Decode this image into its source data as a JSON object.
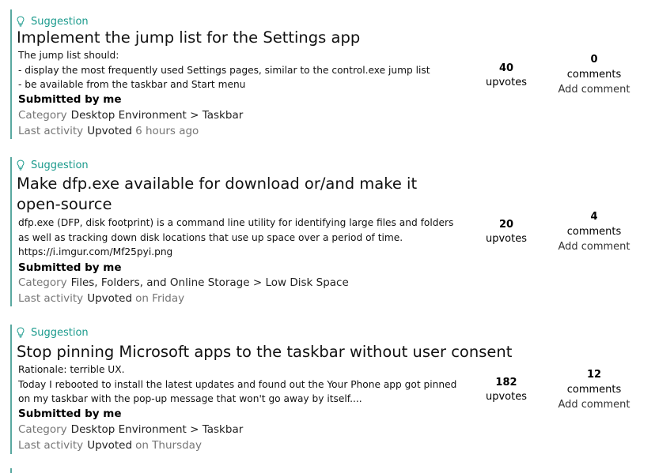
{
  "feedback_items": [
    {
      "type": "Suggestion",
      "title": "Implement the jump list for the Settings app",
      "description": "The jump list should:\n- display the most frequently used Settings pages, similar to the control.exe jump list\n- be available from the taskbar and Start menu",
      "submitted": "Submitted by me",
      "category_label": "Category",
      "category": "Desktop Environment > Taskbar",
      "activity_label": "Last activity",
      "activity": "Upvoted",
      "activity_time": "6 hours ago",
      "upvotes": "40",
      "upvotes_label": "upvotes",
      "comments": "0",
      "comments_label": "comments",
      "add_comment": "Add comment"
    },
    {
      "type": "Suggestion",
      "title": "Make dfp.exe available for download or/and make it open-source",
      "description": "dfp.exe (DFP, disk footprint) is a command line utility for identifying large files and folders as well as tracking down disk locations that use up space over a period of time.  https://i.imgur.com/Mf25pyi.png",
      "submitted": "Submitted by me",
      "category_label": "Category",
      "category": "Files, Folders, and Online Storage > Low Disk Space",
      "activity_label": "Last activity",
      "activity": "Upvoted",
      "activity_time": "on Friday",
      "upvotes": "20",
      "upvotes_label": "upvotes",
      "comments": "4",
      "comments_label": "comments",
      "add_comment": "Add comment"
    },
    {
      "type": "Suggestion",
      "title": "Stop pinning Microsoft apps to the taskbar without user consent",
      "description": "Rationale: terrible UX.\nToday I rebooted to install the latest updates and found out the Your Phone app got pinned on my taskbar with the pop-up message that won't go away by itself....",
      "submitted": "Submitted by me",
      "category_label": "Category",
      "category": "Desktop Environment > Taskbar",
      "activity_label": "Last activity",
      "activity": "Upvoted",
      "activity_time": "on Thursday",
      "upvotes": "182",
      "upvotes_label": "upvotes",
      "comments": "12",
      "comments_label": "comments",
      "add_comment": "Add comment"
    }
  ],
  "icons": {
    "type_icon": "lightbulb-icon"
  },
  "colors": {
    "accent": "#1a9a8c",
    "border": "#5aa8a0",
    "muted": "#767676"
  }
}
